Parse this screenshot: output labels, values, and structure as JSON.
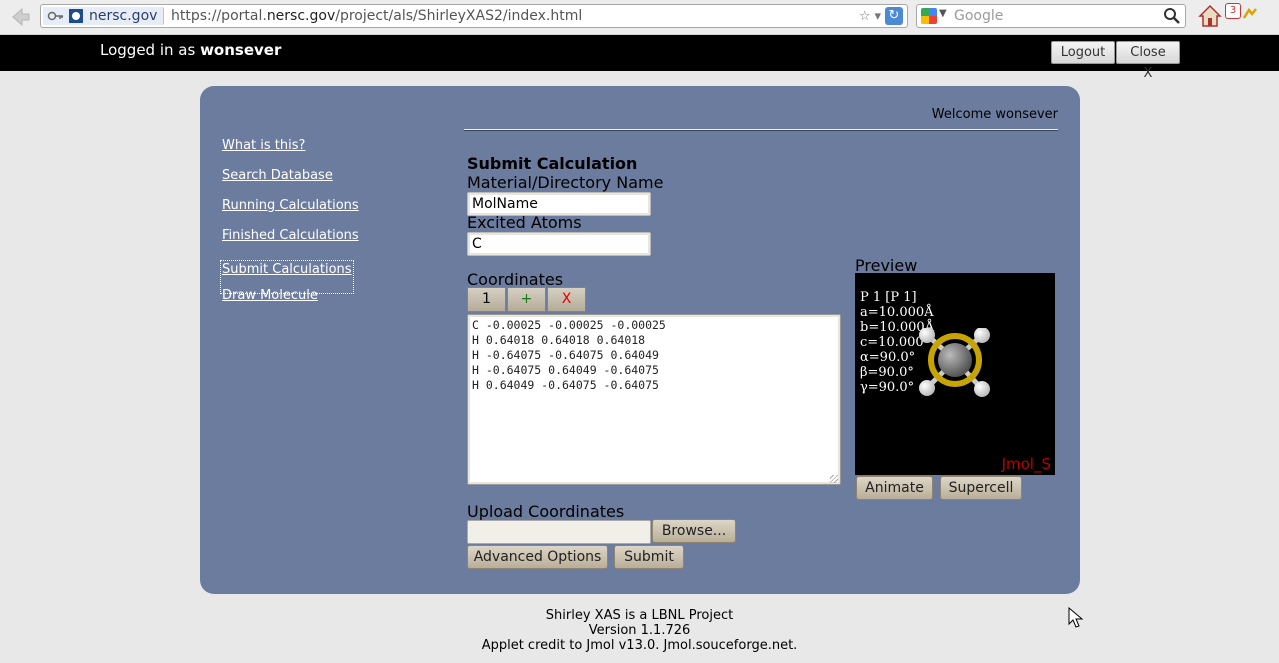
{
  "browser": {
    "site_domain": "nersc.gov",
    "url_prefix": "https://portal.",
    "url_host": "nersc.gov",
    "url_path": "/project/als/ShirleyXAS2/index.html",
    "search_placeholder": "Google",
    "badge_count": "3"
  },
  "topbar": {
    "logged_prefix": "Logged in as ",
    "username": "wonsever",
    "logout_label": "Logout",
    "close_label": "Close X"
  },
  "header": {
    "welcome": "Welcome wonsever"
  },
  "nav": [
    {
      "label": "What is this?"
    },
    {
      "label": "Search Database"
    },
    {
      "label": "Running Calculations"
    },
    {
      "label": "Finished Calculations"
    },
    {
      "label": "Submit Calculations"
    },
    {
      "label": "Draw Molecule"
    }
  ],
  "form": {
    "title": "Submit Calculation",
    "material_label": "Material/Directory Name",
    "material_value": "MolName",
    "excited_label": "Excited Atoms",
    "excited_value": "C",
    "coords_label": "Coordinates",
    "coord_tab_1": "1",
    "coord_tab_add": "+",
    "coord_tab_remove": "X",
    "coords_text": "C -0.00025 -0.00025 -0.00025\nH 0.64018 0.64018 0.64018\nH -0.64075 -0.64075 0.64049\nH -0.64075 0.64049 -0.64075\nH 0.64049 -0.64075 -0.64075",
    "upload_label": "Upload Coordinates",
    "browse_label": "Browse...",
    "advanced_label": "Advanced Options",
    "submit_label": "Submit"
  },
  "preview": {
    "label": "Preview",
    "info_text": "P 1 [P 1]\na=10.000Å\nb=10.000Å\nc=10.000\nα=90.0°\nβ=90.0°\nγ=90.0°",
    "brand": "Jmol_S",
    "animate_label": "Animate",
    "supercell_label": "Supercell"
  },
  "footer": {
    "line1": "Shirley XAS is a LBNL Project",
    "line2": "Version 1.1.726",
    "line3": "Applet credit to Jmol v13.0. Jmol.souceforge.net."
  },
  "colors": {
    "panel": "#6c7c9e",
    "topbar": "#000000",
    "button_face": "#c9c0ae"
  }
}
